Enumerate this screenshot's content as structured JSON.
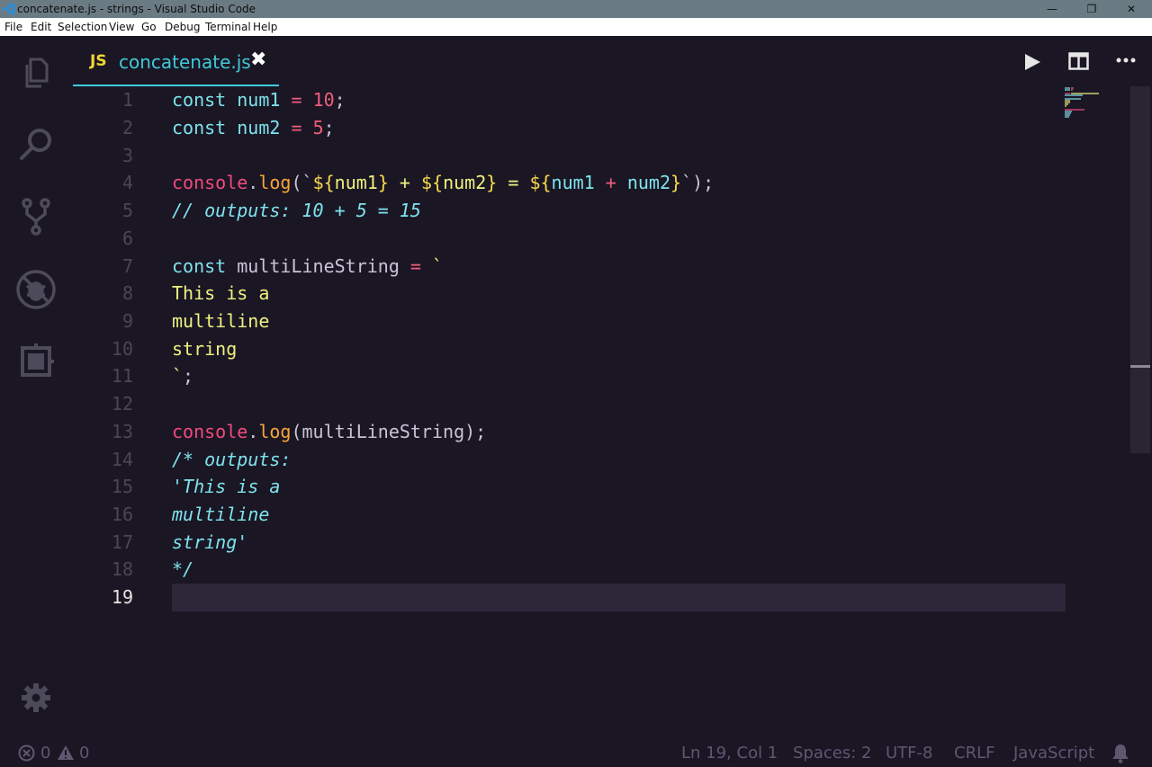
{
  "window": {
    "title": "concatenate.js - strings - Visual Studio Code",
    "controls": {
      "minimize": "—",
      "restore": "❐",
      "close": "✕"
    }
  },
  "menu": {
    "items": [
      {
        "label": "File"
      },
      {
        "label": "Edit"
      },
      {
        "label": "Selection"
      },
      {
        "label": "View"
      },
      {
        "label": "Go"
      },
      {
        "label": "Debug"
      },
      {
        "label": "Terminal"
      },
      {
        "label": "Help"
      }
    ]
  },
  "activity_bar": {
    "icons": [
      "explorer-icon",
      "search-icon",
      "source-control-icon",
      "debug-icon",
      "extensions-icon",
      "gear-icon"
    ]
  },
  "tab": {
    "badge": "JS",
    "filename": "concatenate.js",
    "close": "✖"
  },
  "editor_actions": {
    "run": "▶",
    "split": "◫",
    "more": "•••"
  },
  "editor": {
    "current_line": 19,
    "lines": [
      {
        "n": "1"
      },
      {
        "n": "2"
      },
      {
        "n": "3"
      },
      {
        "n": "4"
      },
      {
        "n": "5"
      },
      {
        "n": "6"
      },
      {
        "n": "7"
      },
      {
        "n": "8"
      },
      {
        "n": "9"
      },
      {
        "n": "10"
      },
      {
        "n": "11"
      },
      {
        "n": "12"
      },
      {
        "n": "13"
      },
      {
        "n": "14"
      },
      {
        "n": "15"
      },
      {
        "n": "16"
      },
      {
        "n": "17"
      },
      {
        "n": "18"
      },
      {
        "n": "19"
      }
    ],
    "tokens": {
      "l1": [
        "const",
        " num1 ",
        "=",
        " ",
        "10",
        ";"
      ],
      "l2": [
        "const",
        " num2 ",
        "=",
        " ",
        "5",
        ";"
      ],
      "l4": [
        "console",
        ".",
        "log",
        "(`",
        "${",
        "num1",
        "}",
        " + ",
        "${",
        "num2",
        "}",
        " = ",
        "${",
        "num1 ",
        "+",
        " num2",
        "}",
        "`);"
      ],
      "l5": "// outputs: 10 + 5 = 15",
      "l7": [
        "const",
        " multiLineString ",
        "=",
        " `"
      ],
      "l8": "This is a",
      "l9": "multiline",
      "l10": "string",
      "l11": [
        "`",
        ";"
      ],
      "l13": [
        "console",
        ".",
        "log",
        "(multiLineString);"
      ],
      "l14": "/* outputs:",
      "l15": "'This is a",
      "l16": "multiline",
      "l17": "string'",
      "l18": "*/"
    }
  },
  "status": {
    "errors": "0",
    "warnings": "0",
    "position": "Ln 19, Col 1",
    "spaces": "Spaces: 2",
    "encoding": "UTF-8",
    "eol": "CRLF",
    "language": "JavaScript"
  },
  "colors": {
    "background": "#1b1624",
    "accent": "#3fcbd8",
    "keyword": "#7ee3ec",
    "operator": "#f25c7b",
    "string": "#eef280",
    "function": "#f7a43a"
  }
}
